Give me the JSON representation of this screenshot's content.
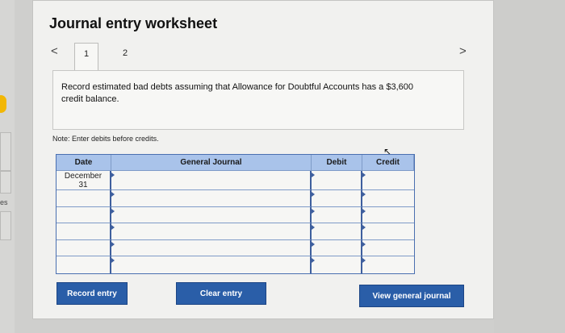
{
  "worksheet": {
    "title": "Journal entry worksheet",
    "prev_arrow": "<",
    "next_arrow": ">",
    "tabs": [
      {
        "label": "1"
      },
      {
        "label": "2"
      }
    ],
    "instruction": "Record estimated bad debts assuming that Allowance for Doubtful Accounts has a $3,600 credit balance.",
    "note": "Note: Enter debits before credits."
  },
  "journal": {
    "columns": [
      "Date",
      "General Journal",
      "Debit",
      "Credit"
    ],
    "rows": [
      {
        "date": "December\n31",
        "account": "",
        "debit": "",
        "credit": ""
      },
      {
        "date": "",
        "account": "",
        "debit": "",
        "credit": ""
      },
      {
        "date": "",
        "account": "",
        "debit": "",
        "credit": ""
      },
      {
        "date": "",
        "account": "",
        "debit": "",
        "credit": ""
      },
      {
        "date": "",
        "account": "",
        "debit": "",
        "credit": ""
      },
      {
        "date": "",
        "account": "",
        "debit": "",
        "credit": ""
      }
    ]
  },
  "buttons": {
    "record": "Record entry",
    "clear": "Clear entry",
    "view": "View general journal"
  },
  "sidebar": {
    "fragment": "es"
  },
  "colors": {
    "button_blue": "#2a5ea8",
    "header_blue": "#a9c3ea",
    "accent_yellow": "#f2b705"
  }
}
